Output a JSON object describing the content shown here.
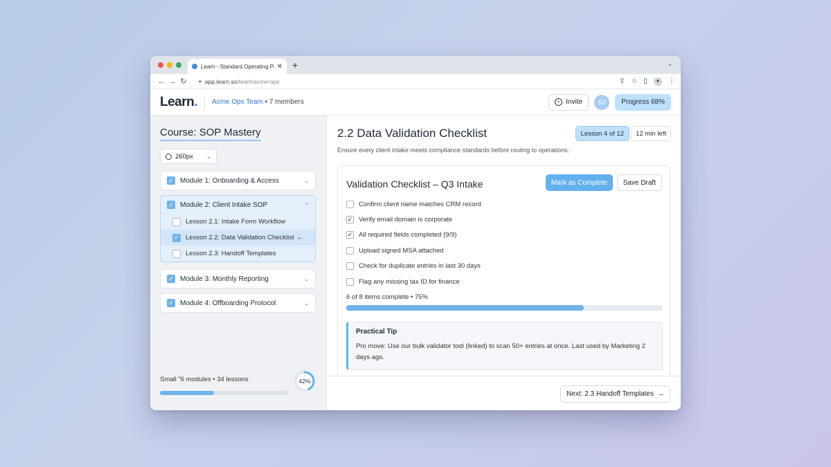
{
  "browser": {
    "tab_title": "Learn - Standard Operating Procedures",
    "tab_close": "✕",
    "new_tab": "+",
    "url_host": "app.learn.so",
    "url_path": "/team/acme-ops"
  },
  "header": {
    "logo": "Learn",
    "logo_dot": ".",
    "team_name": "Acme Ops Team",
    "team_members": " • 7 members",
    "invite_label": "Invite",
    "avatar_initials": "SJ",
    "progress_label": "Progress 68%"
  },
  "sidebar": {
    "course_title": "Course: SOP Mastery",
    "width_select": "260px",
    "modules": [
      {
        "label": "Module 1: Onboarding & Access",
        "checked": true
      },
      {
        "label": "Module 2: Client Intake SOP",
        "checked": true
      },
      {
        "label": "Module 3: Monthly Reporting",
        "checked": true
      },
      {
        "label": "Module 4: Offboarding Protocol",
        "checked": true
      }
    ],
    "lessons": [
      {
        "label": "Lesson 2.1: Intake Form Workflow",
        "checked": false
      },
      {
        "label": "Lesson 2.2: Data Validation Checklist",
        "checked": true,
        "arrow": "←"
      },
      {
        "label": "Lesson 2.3: Handoff Templates",
        "checked": false
      }
    ],
    "footer_label": "Small \"6 modules • 34 lessons",
    "footer_progress_fraction": 0.42,
    "ring_label": "42%"
  },
  "main": {
    "title": "2.2 Data Validation Checklist",
    "subtitle": "Ensure every client intake meets compliance standards before routing to operations.",
    "lesson_pill": "Lesson 4 of 12",
    "time_left": "12 min left",
    "card": {
      "title": "Validation Checklist – Q3 Intake",
      "complete_button": "Mark as Complete",
      "draft_button": "Save Draft",
      "items": [
        {
          "label": "Confirm client name matches CRM record",
          "checked": false
        },
        {
          "label": "Verify email domain is corporate",
          "checked": true
        },
        {
          "label": "All required fields completed (9/9)",
          "checked": true
        },
        {
          "label": "Upload signed MSA attached",
          "checked": false
        },
        {
          "label": "Check for duplicate entries in last 30 days",
          "checked": false
        },
        {
          "label": "Flag any missing tax ID for finance",
          "checked": false
        }
      ],
      "summary": "6 of 8 items complete • 75%",
      "progress_fraction": 0.75,
      "tip_heading": "Practical Tip",
      "tip_body": "Pro move: Use our bulk validator tool (linked) to scan 50+ entries at once. Last used by Marketing 2 days ago."
    },
    "next_button": "Next: 2.3 Handoff Templates",
    "next_arrow": "→"
  },
  "colors": {
    "accent": "#63b0ee",
    "accent_light": "#bfe0fb",
    "link": "#2f6fd6"
  }
}
